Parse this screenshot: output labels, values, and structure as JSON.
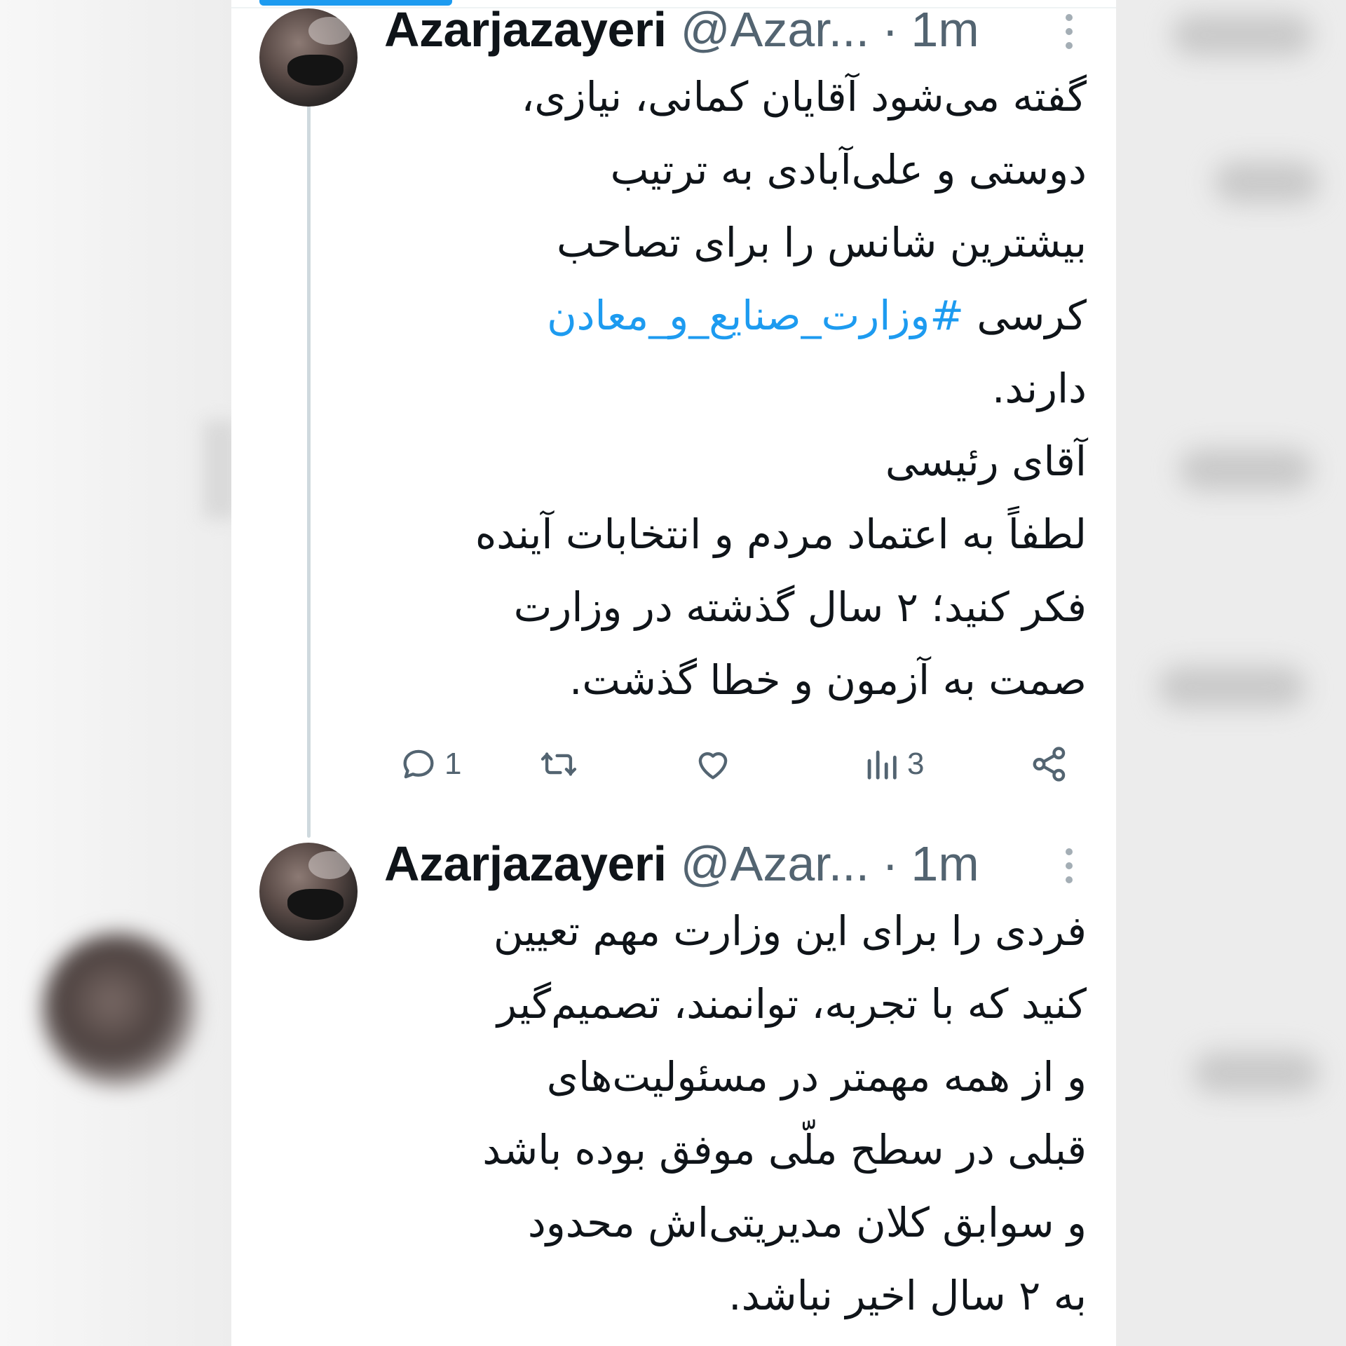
{
  "tweets": [
    {
      "display_name": "Azarjazayeri",
      "handle": "@Azar...",
      "separator": "·",
      "time": "1m",
      "lines": [
        {
          "text": "گفته می‌شود آقایان کمانی، نیازی،"
        },
        {
          "text": "دوستی و علی‌آبادی به ترتیب"
        },
        {
          "text": "بیشترین شانس را برای تصاحب"
        },
        {
          "text": "کرسی ",
          "hashtag": "#وزارت_صنایع_و_معادن"
        },
        {
          "text": "دارند."
        },
        {
          "text": "آقای رئیسی"
        },
        {
          "text": "لطفاً به اعتماد مردم و انتخابات آینده"
        },
        {
          "text": "فکر کنید؛ ۲ سال گذشته در وزارت"
        },
        {
          "text": "صمت به آزمون و خطا گذشت."
        }
      ],
      "actions": {
        "reply_count": "1",
        "views_count": "3"
      }
    },
    {
      "display_name": "Azarjazayeri",
      "handle": "@Azar...",
      "separator": "·",
      "time": "1m",
      "lines": [
        {
          "text": "فردی را برای این وزارت مهم تعیین"
        },
        {
          "text": "کنید که با تجربه، توانمند، تصمیم‌گیر"
        },
        {
          "text": "و از همه مهمتر در مسئولیت‌های"
        },
        {
          "text": "قبلی در سطح ملّی موفق بوده باشد"
        },
        {
          "text": "و سوابق کلان مدیریتی‌اش محدود"
        },
        {
          "text": "به ۲ سال اخیر نباشد."
        }
      ]
    }
  ],
  "colors": {
    "accent": "#1d9bf0",
    "text": "#0f1419",
    "secondary": "#536471",
    "thread_line": "#cfd9de"
  },
  "icons": {
    "reply": "reply-icon",
    "retweet": "retweet-icon",
    "like": "heart-icon",
    "views": "views-icon",
    "share": "share-icon",
    "more": "more-vertical-icon"
  }
}
